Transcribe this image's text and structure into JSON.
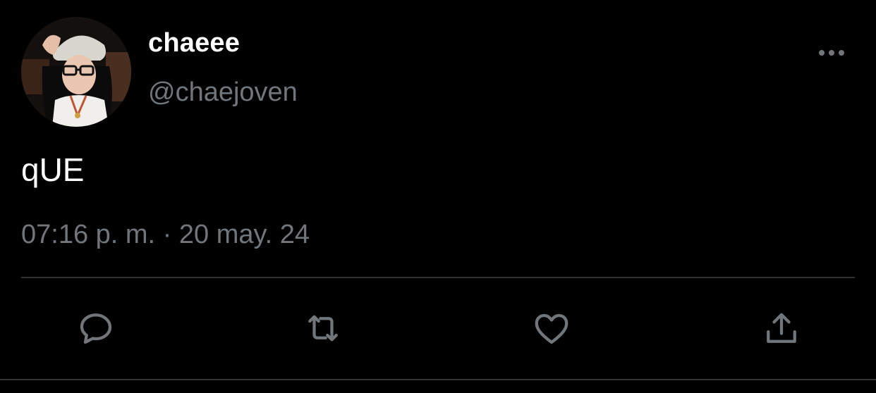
{
  "tweet": {
    "display_name": "chaeee",
    "handle": "@chaejoven",
    "text": "qUE",
    "timestamp": "07:16 p. m. · 20 may. 24"
  },
  "icons": {
    "more": "more-dots-icon",
    "reply": "reply-bubble-icon",
    "retweet": "retweet-arrows-icon",
    "like": "heart-icon",
    "share": "share-upload-icon"
  },
  "colors": {
    "background": "#000000",
    "primary_text": "#ffffff",
    "secondary_text": "#71767b",
    "divider": "#2f3336"
  }
}
